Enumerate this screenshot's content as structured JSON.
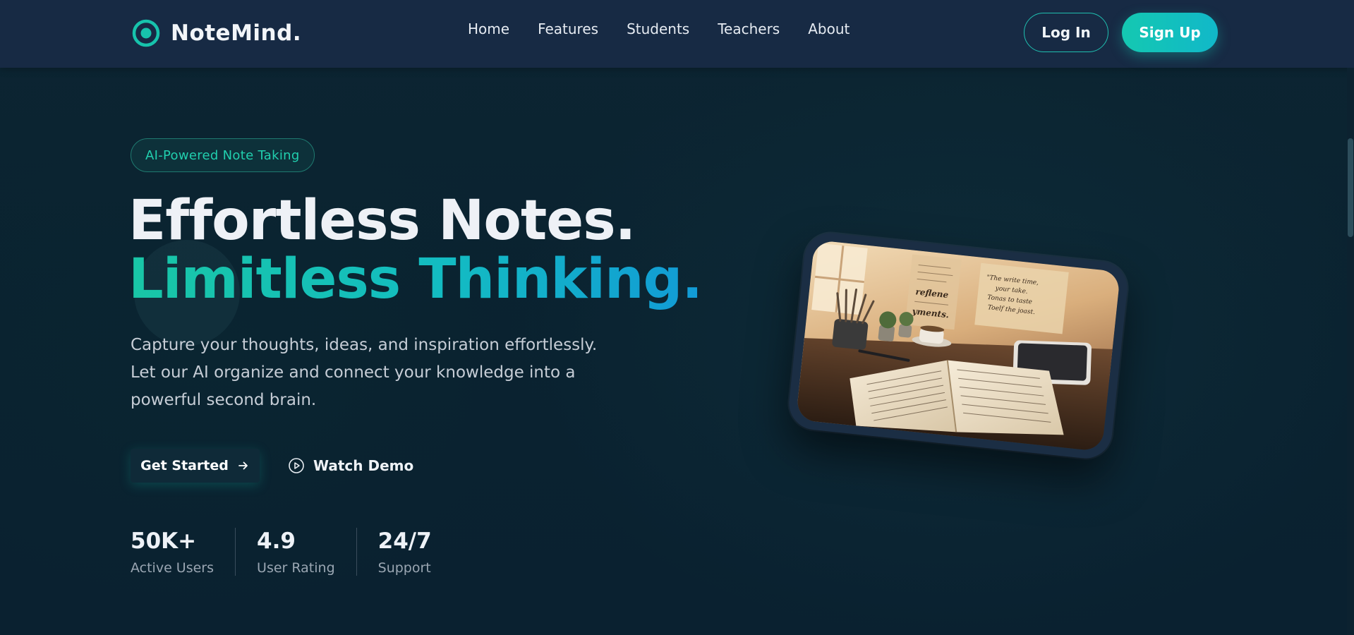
{
  "header": {
    "brand": "NoteMind.",
    "logo_icon": "target-circle-icon",
    "nav": [
      {
        "label": "Home"
      },
      {
        "label": "Features"
      },
      {
        "label": "Students"
      },
      {
        "label": "Teachers"
      },
      {
        "label": "About"
      }
    ],
    "login_label": "Log In",
    "signup_label": "Sign Up"
  },
  "hero": {
    "badge": "AI-Powered Note Taking",
    "headline_line1": "Effortless Notes.",
    "headline_line2": "Limitless Thinking.",
    "description": "Capture your thoughts, ideas, and inspiration effortlessly. Let our AI organize and connect your knowledge into a powerful second brain.",
    "primary_cta": "Get Started",
    "primary_cta_icon": "arrow-right-icon",
    "secondary_cta": "Watch Demo",
    "secondary_cta_icon": "play-circle-icon",
    "stats": [
      {
        "value": "50K+",
        "label": "Active Users"
      },
      {
        "value": "4.9",
        "label": "User Rating"
      },
      {
        "value": "24/7",
        "label": "Support"
      }
    ],
    "image_handwriting": {
      "card_line1": "\"The write time,",
      "card_line2": "your take.",
      "card_line3": "Tonas to taste",
      "card_line4": "Toelf the joast.",
      "page_word1": "reflene",
      "page_word2": "yments."
    }
  },
  "colors": {
    "accent": "#14c8b1",
    "accent_blue": "#129ad6",
    "header_bg": "#172a44",
    "page_bg": "#0b2230"
  }
}
